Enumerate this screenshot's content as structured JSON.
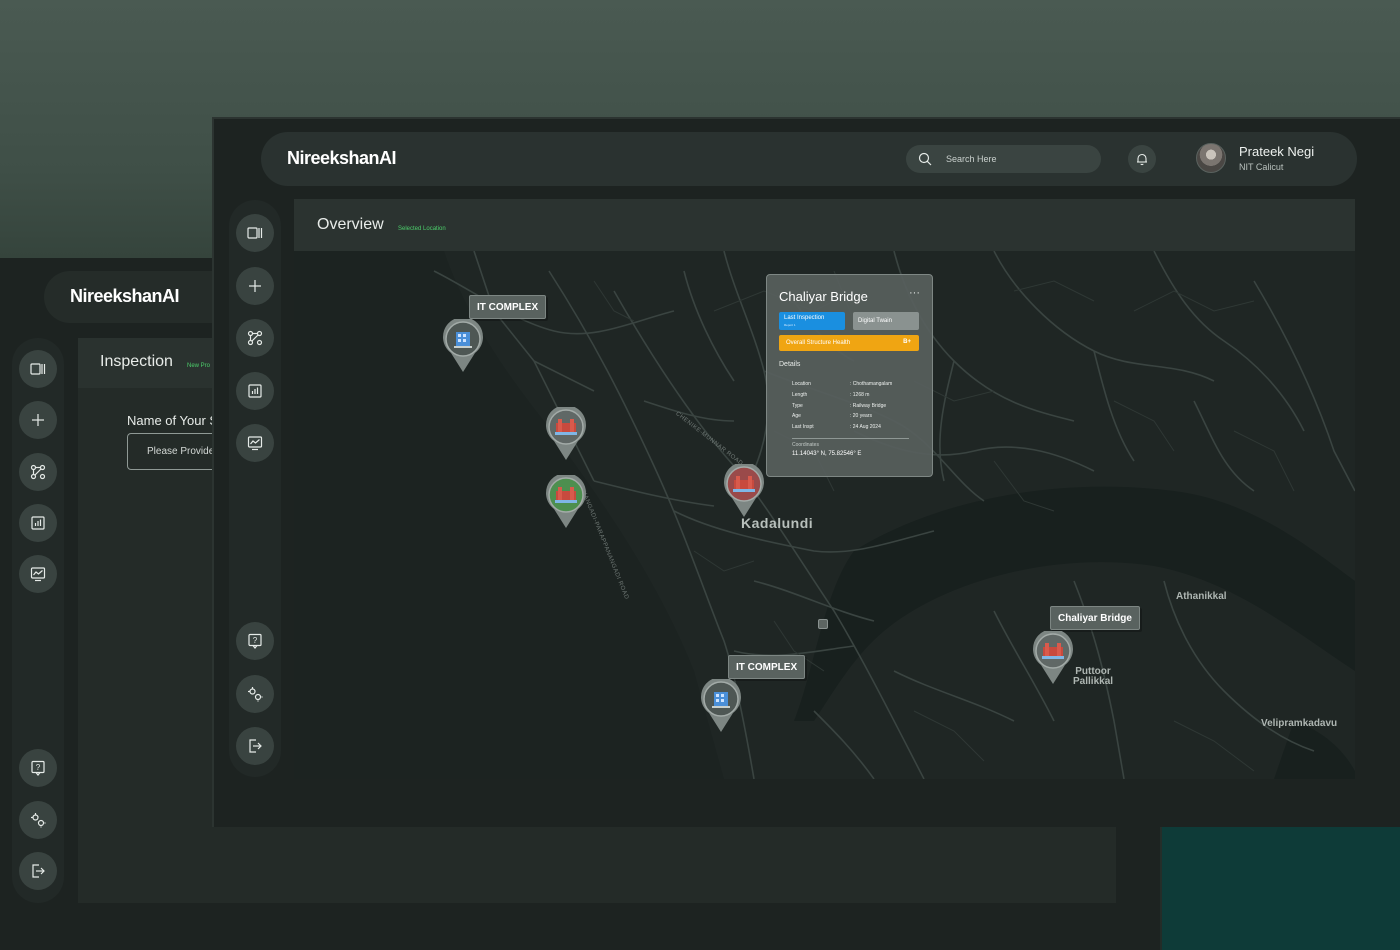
{
  "brand": {
    "logo_text": "NireekshanAI"
  },
  "back_window": {
    "logo_text": "NireekshanAI",
    "panel_title": "Inspection",
    "panel_badge": "New Pro",
    "name_label": "Name of Your S",
    "name_placeholder": "Please Provide N"
  },
  "header": {
    "search_placeholder": "Search Here",
    "user_name": "Prateek Negi",
    "user_org": "NIT Calicut"
  },
  "sidebar": {
    "items": [
      {
        "icon": "panel-icon"
      },
      {
        "icon": "plus-icon"
      },
      {
        "icon": "flow-icon"
      },
      {
        "icon": "report-icon"
      },
      {
        "icon": "monitor-chart-icon"
      }
    ],
    "bottom_items": [
      {
        "icon": "help-icon"
      },
      {
        "icon": "settings-icon"
      },
      {
        "icon": "logout-icon"
      }
    ]
  },
  "overview": {
    "title": "Overview",
    "subtitle": "Selected Location"
  },
  "map": {
    "places": {
      "kadalundi": "Kadalundi",
      "athanikkal": "Athanikkal",
      "puttoor_line1": "Puttoor",
      "puttoor_line2": "Pallikkal",
      "velipramkadavu": "Velipramkadavu"
    },
    "road_labels": {
      "a": "ANANGADI-PARAPPANANGADI ROAD",
      "b": "CHENIKE-MUNNAR ROAD"
    },
    "tags": {
      "it_complex_1": "IT COMPLEX",
      "it_complex_2": "IT COMPLEX",
      "chaliyar": "Chaliyar Bridge"
    },
    "pin_colors": {
      "building": "#4a8fd8",
      "bridge_gray": "#606866",
      "bridge_red": "#9a4a4a",
      "bridge_green": "#4d8f4f"
    }
  },
  "card": {
    "title": "Chaliyar Bridge",
    "menu": "···",
    "tab_active": "Last Inspection",
    "tab_active_sub": "Report 1",
    "tab_other": "Digital Twain",
    "health_label": "Overall Structure Health",
    "health_value": "B+",
    "health_color": "#f0a512",
    "details_label": "Details",
    "details": [
      {
        "key": "Location",
        "value": ": Chothamangalam"
      },
      {
        "key": "Length",
        "value": ": 1268 m"
      },
      {
        "key": "Type",
        "value": ": Railway Bridge"
      },
      {
        "key": "Age",
        "value": ": 20 years"
      },
      {
        "key": "Last Inspt",
        "value": ": 24 Aug 2024"
      }
    ],
    "coordinates_label": "Coordinates",
    "coordinates_value": "11.14043° N, 75.82546° E"
  }
}
